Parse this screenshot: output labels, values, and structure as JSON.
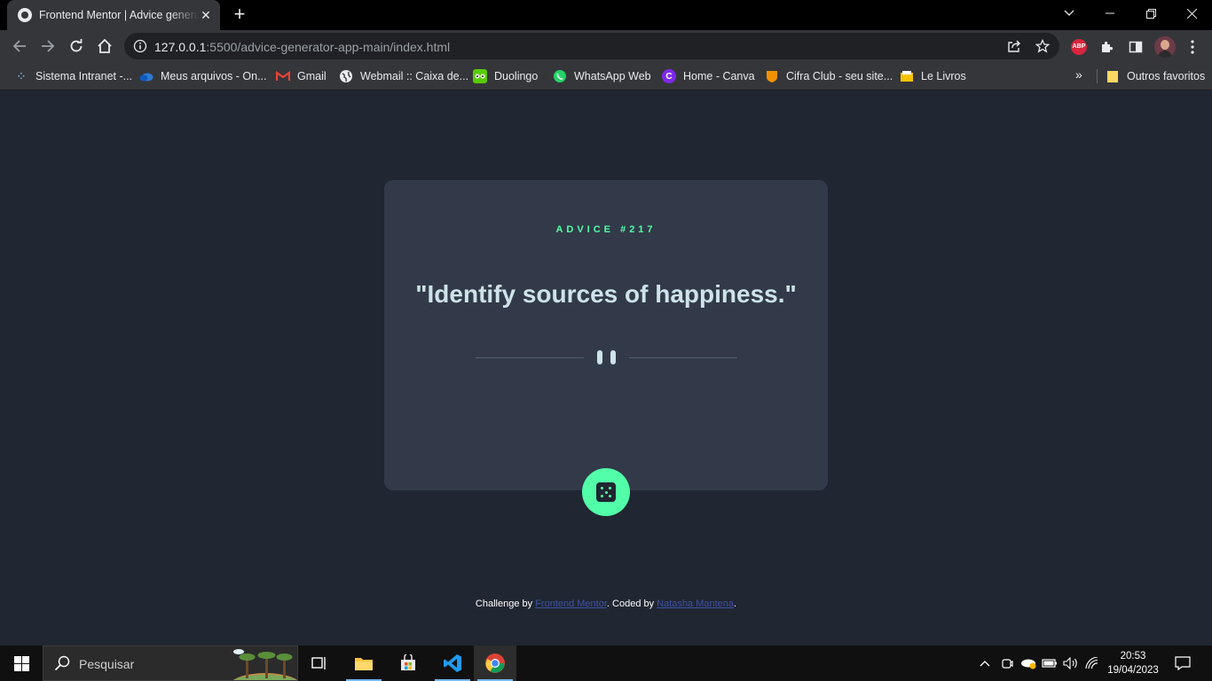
{
  "browser": {
    "tab_title": "Frontend Mentor | Advice generator app",
    "url_host": "127.0.0.1",
    "url_rest": ":5500/advice-generator-app-main/index.html",
    "bookmarks": [
      {
        "label": "Sistema Intranet -...",
        "icon": "intranet-icon",
        "color": "#8ab4f8"
      },
      {
        "label": "Meus arquivos - On...",
        "icon": "onedrive-icon",
        "color": "#2b7cd3"
      },
      {
        "label": "Gmail",
        "icon": "gmail-icon",
        "color": "#ea4335"
      },
      {
        "label": "Webmail :: Caixa de...",
        "icon": "globe-icon",
        "color": "#e8eaed"
      },
      {
        "label": "Duolingo",
        "icon": "duolingo-icon",
        "color": "#58cc02"
      },
      {
        "label": "WhatsApp Web",
        "icon": "whatsapp-icon",
        "color": "#25d366"
      },
      {
        "label": "Home - Canva",
        "icon": "canva-icon",
        "color": "#7d2ae8"
      },
      {
        "label": "Cifra Club - seu site...",
        "icon": "cifraclub-icon",
        "color": "#f39200"
      },
      {
        "label": "Le Livros",
        "icon": "lelivros-icon",
        "color": "#f5c400"
      }
    ],
    "other_bookmarks": "Outros favoritos"
  },
  "advice": {
    "id_label": "ADVICE #217",
    "text": "\"Identify sources of happiness.\""
  },
  "attribution": {
    "prefix": "Challenge by ",
    "link1": "Frontend Mentor",
    "middle": ". Coded by ",
    "link2": "Natasha Mantena",
    "suffix": "."
  },
  "taskbar": {
    "search_placeholder": "Pesquisar",
    "time": "20:53",
    "date": "19/04/2023"
  },
  "colors": {
    "accent": "#52ffa8",
    "card": "#323a49",
    "background": "#202632",
    "quote": "#cee3e9",
    "link": "#3e52a3"
  }
}
